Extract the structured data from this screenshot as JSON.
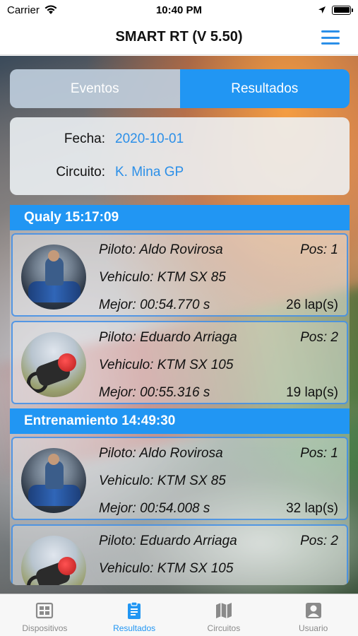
{
  "status_bar": {
    "carrier": "Carrier",
    "time": "10:40 PM"
  },
  "nav": {
    "title": "SMART RT (V 5.50)",
    "menu_icon": "hamburger-menu-icon"
  },
  "segment": {
    "tabs": [
      {
        "label": "Eventos",
        "selected": false
      },
      {
        "label": "Resultados",
        "selected": true
      }
    ]
  },
  "info": {
    "fecha_label": "Fecha:",
    "fecha_value": "2020-10-01",
    "circuito_label": "Circuito:",
    "circuito_value": "K. Mina GP"
  },
  "sections": [
    {
      "title": "Qualy 15:17:09",
      "results": [
        {
          "piloto": "Piloto: Aldo Rovirosa",
          "pos": "Pos: 1",
          "vehiculo": "Vehiculo: KTM SX 85",
          "mejor": "Mejor: 00:54.770 s",
          "laps": "26 lap(s)"
        },
        {
          "piloto": "Piloto: Eduardo Arriaga",
          "pos": "Pos: 2",
          "vehiculo": "Vehiculo: KTM SX 105",
          "mejor": "Mejor: 00:55.316 s",
          "laps": "19 lap(s)"
        }
      ]
    },
    {
      "title": "Entrenamiento 14:49:30",
      "results": [
        {
          "piloto": "Piloto: Aldo Rovirosa",
          "pos": "Pos: 1",
          "vehiculo": "Vehiculo: KTM SX 85",
          "mejor": "Mejor: 00:54.008 s",
          "laps": "32 lap(s)"
        },
        {
          "piloto": "Piloto: Eduardo Arriaga",
          "pos": "Pos: 2",
          "vehiculo": "Vehiculo: KTM SX 105"
        }
      ]
    }
  ],
  "tab_bar": {
    "tabs": [
      {
        "label": "Dispositivos",
        "icon": "devices-icon",
        "active": false
      },
      {
        "label": "Resultados",
        "icon": "clipboard-icon",
        "active": true
      },
      {
        "label": "Circuitos",
        "icon": "map-icon",
        "active": false
      },
      {
        "label": "Usuario",
        "icon": "user-icon",
        "active": false
      }
    ]
  },
  "colors": {
    "accent": "#2196f3",
    "link": "#2b8fe8",
    "inactive_tab": "#8a8a8a"
  }
}
